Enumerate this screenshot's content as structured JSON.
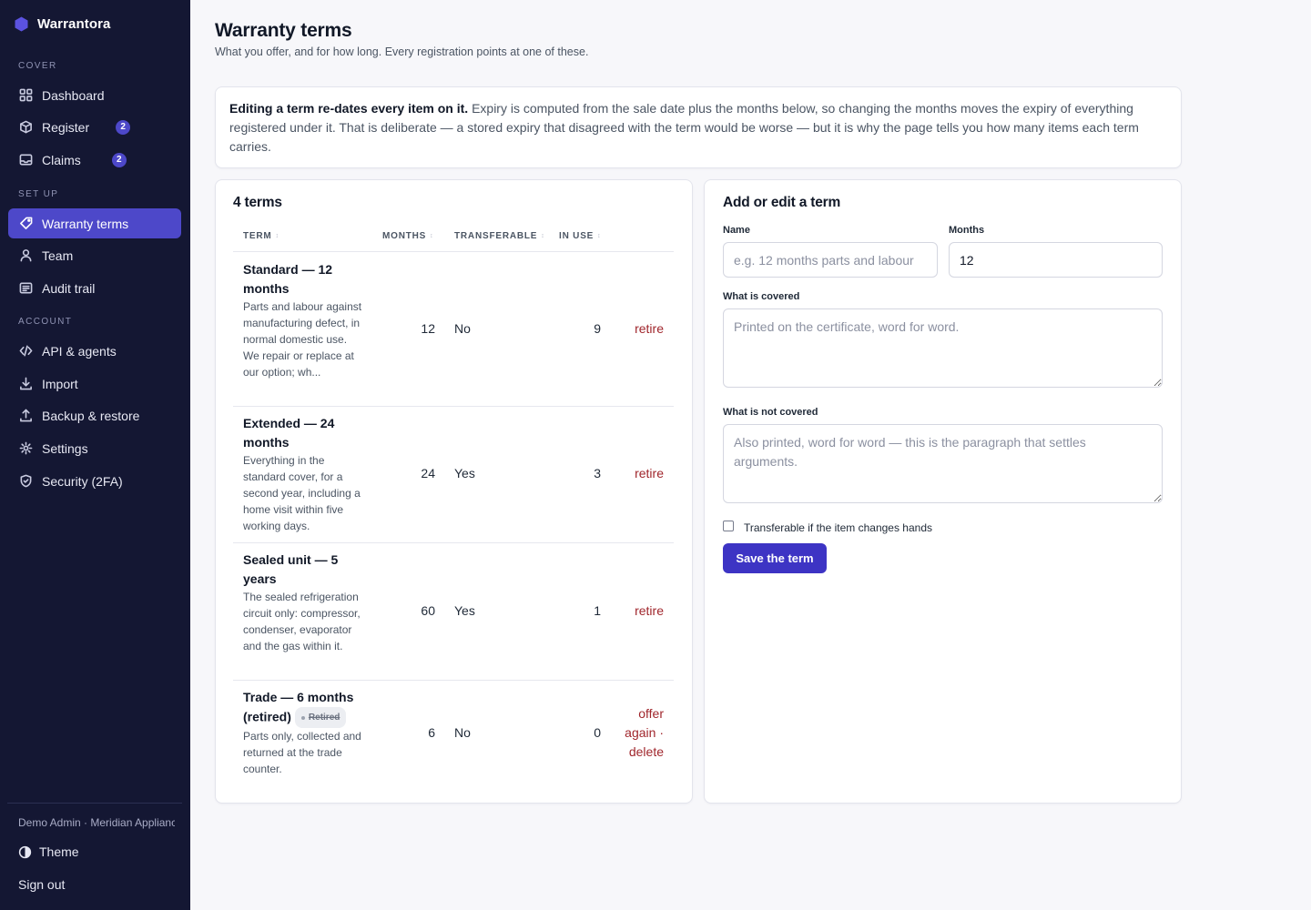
{
  "app": {
    "name": "Warrantora",
    "brand_color": "#4d48c9"
  },
  "sidebar": {
    "sections": [
      {
        "label": "COVER",
        "items": [
          {
            "label": "Dashboard",
            "icon": "grid-icon"
          },
          {
            "label": "Register",
            "icon": "box-icon",
            "badge": "2"
          },
          {
            "label": "Claims",
            "icon": "inbox-icon",
            "badge": "2"
          }
        ]
      },
      {
        "label": "SET UP",
        "items": [
          {
            "label": "Warranty terms",
            "icon": "tag-icon",
            "active": true
          },
          {
            "label": "Team",
            "icon": "user-icon"
          },
          {
            "label": "Audit trail",
            "icon": "list-icon"
          }
        ]
      },
      {
        "label": "ACCOUNT",
        "items": [
          {
            "label": "API & agents",
            "icon": "code-icon"
          },
          {
            "label": "Import",
            "icon": "download-icon"
          },
          {
            "label": "Backup & restore",
            "icon": "upload-icon"
          },
          {
            "label": "Settings",
            "icon": "gear-icon"
          },
          {
            "label": "Security (2FA)",
            "icon": "shield-icon"
          }
        ]
      }
    ],
    "user": "Demo Admin · Meridian Appliances",
    "theme_label": "Theme",
    "signout_label": "Sign out"
  },
  "page": {
    "title": "Warranty terms",
    "subtitle": "What you offer, and for how long. Every registration points at one of these."
  },
  "notice": {
    "bold": "Editing a term re-dates every item on it.",
    "text": " Expiry is computed from the sale date plus the months below, so changing the months moves the expiry of everything registered under it. That is deliberate — a stored expiry that disagreed with the term would be worse — but it is why the page tells you how many items each term carries."
  },
  "terms": {
    "title": "4 terms",
    "columns": [
      "TERM",
      "MONTHS",
      "TRANSFERABLE",
      "IN USE"
    ],
    "rows": [
      {
        "name": "Standard — 12 months",
        "description": "Parts and labour against manufacturing defect, in normal domestic use. We repair or replace at our option; wh...",
        "months": "12",
        "transferable": "No",
        "in_use": "9",
        "action": "retire"
      },
      {
        "name": "Extended — 24 months",
        "description": "Everything in the standard cover, for a second year, including a home visit within five working days.",
        "months": "24",
        "transferable": "Yes",
        "in_use": "3",
        "action": "retire"
      },
      {
        "name": "Sealed unit — 5 years",
        "description": "The sealed refrigeration circuit only: compressor, condenser, evaporator and the gas within it.",
        "months": "60",
        "transferable": "Yes",
        "in_use": "1",
        "action": "retire"
      },
      {
        "name": "Trade — 6 months (retired)",
        "status_badge": "Retired",
        "description": "Parts only, collected and returned at the trade counter.",
        "months": "6",
        "transferable": "No",
        "in_use": "0",
        "action_offer": "offer again",
        "action_delete": "· delete"
      }
    ]
  },
  "form": {
    "title": "Add or edit a term",
    "name_label": "Name",
    "name_placeholder": "e.g. 12 months parts and labour",
    "months_label": "Months",
    "months_value": "12",
    "covered_label": "What is covered",
    "covered_placeholder": "Printed on the certificate, word for word.",
    "not_covered_label": "What is not covered",
    "not_covered_placeholder": "Also printed, word for word — this is the paragraph that settles arguments.",
    "transferable_label": "Transferable if the item changes hands",
    "save_label": "Save the term"
  }
}
